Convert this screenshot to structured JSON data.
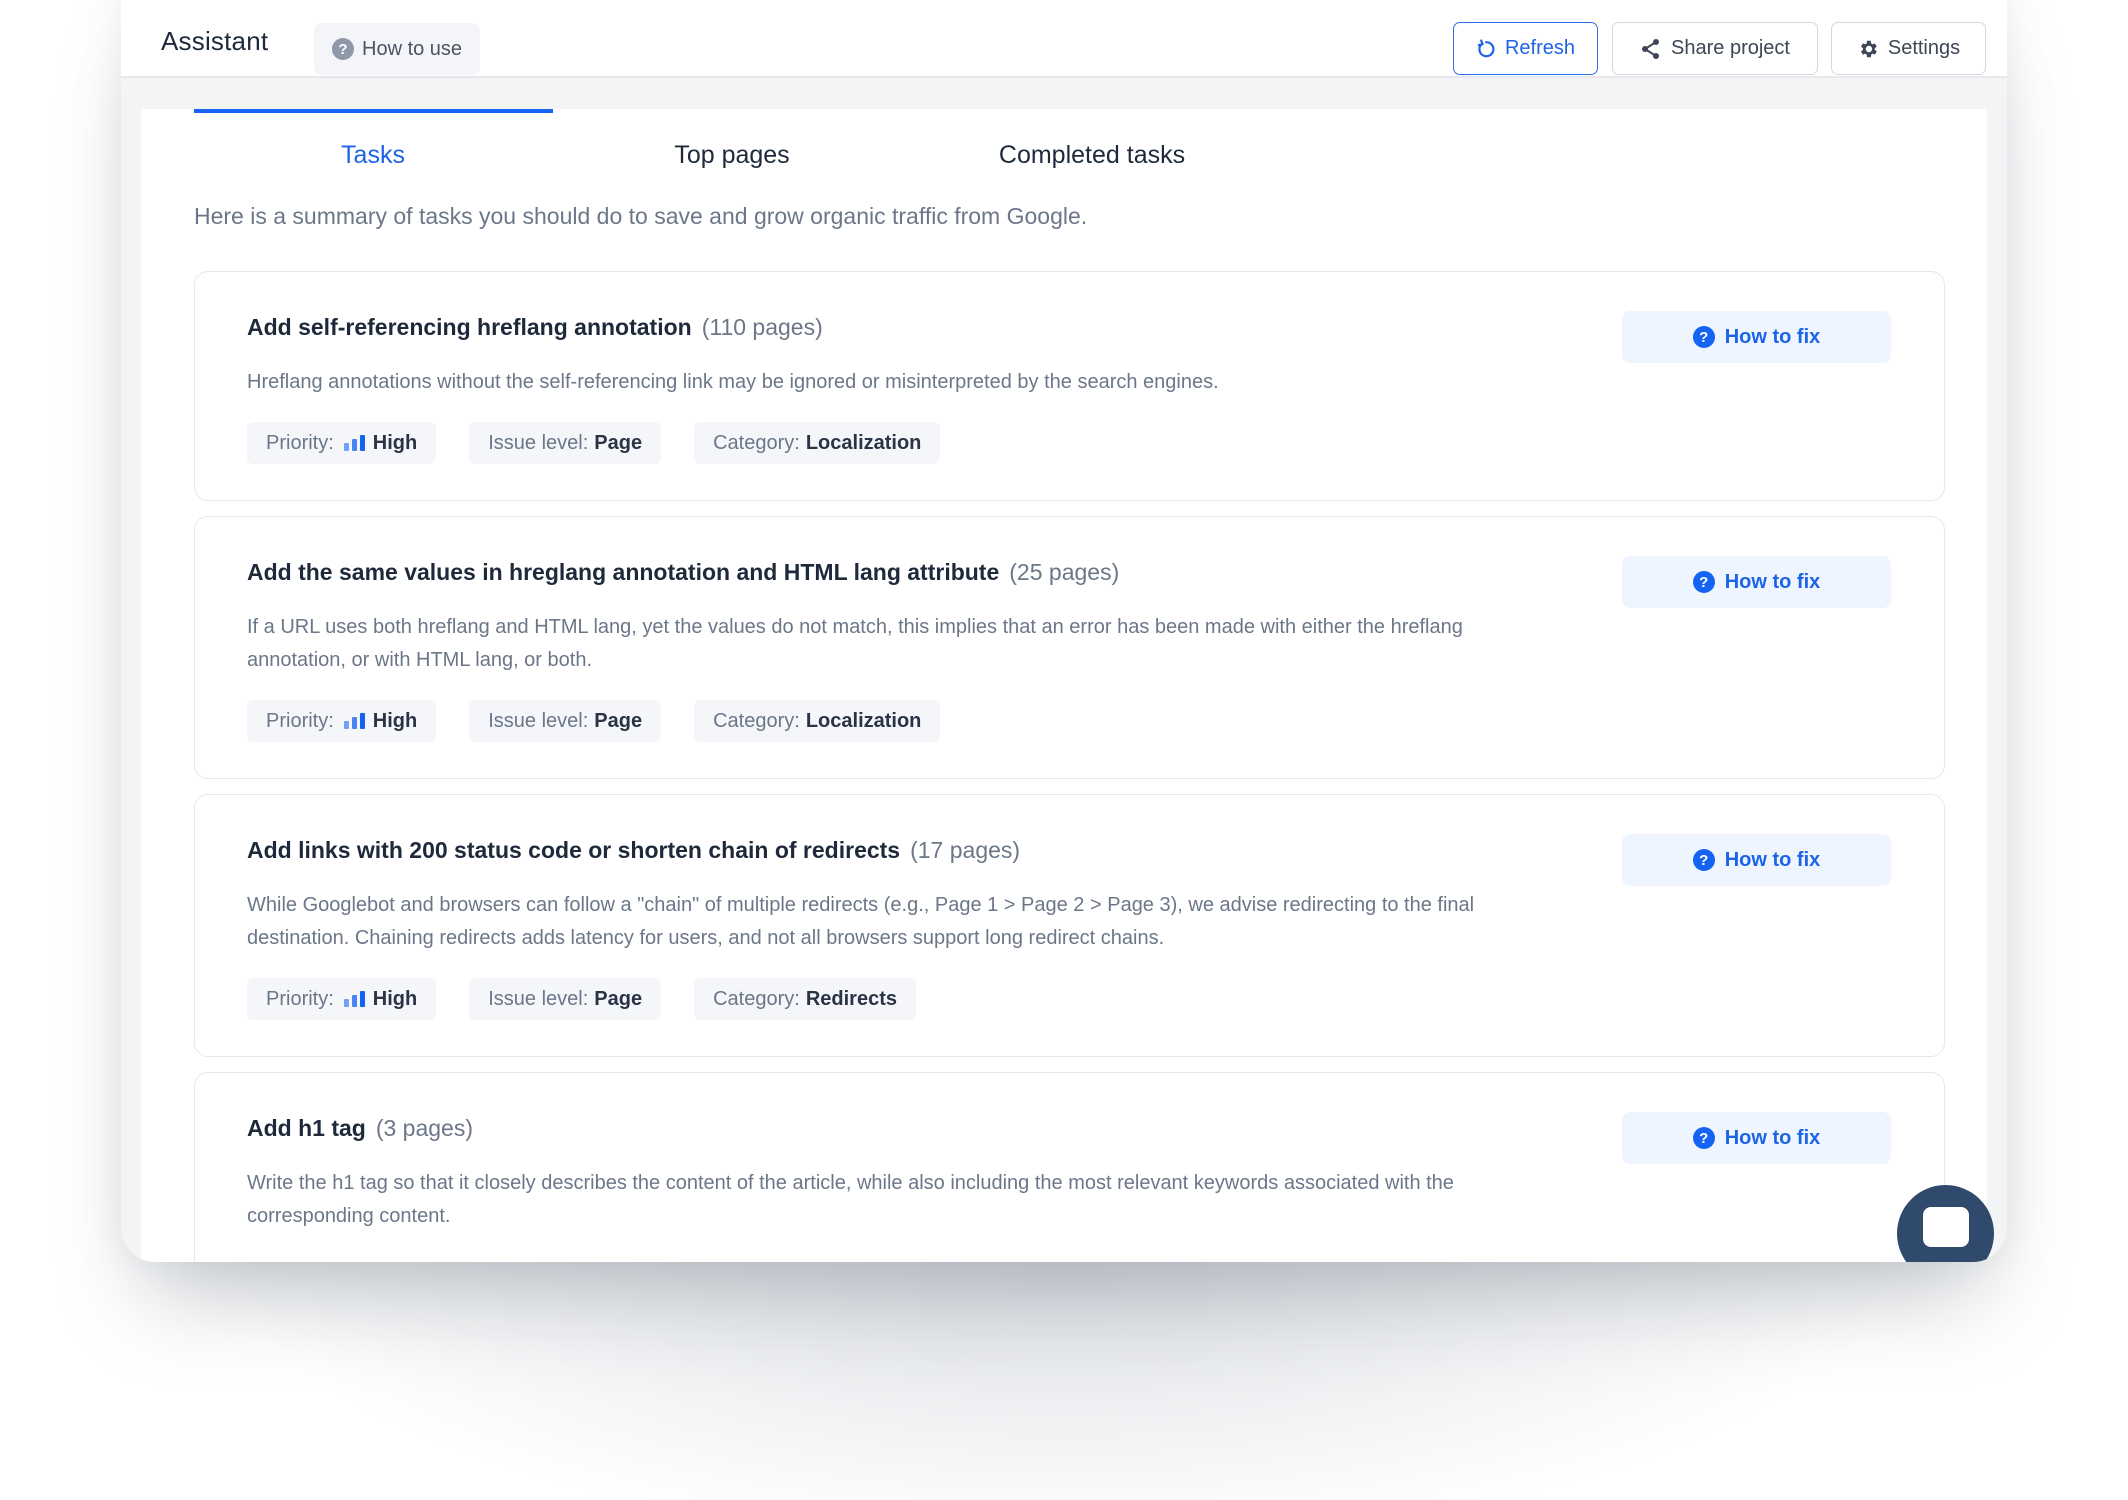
{
  "header": {
    "title": "Assistant",
    "how_to_use": "How to use",
    "buttons": {
      "refresh": "Refresh",
      "share": "Share project",
      "settings": "Settings"
    }
  },
  "tabs": [
    {
      "label": "Tasks",
      "active": true
    },
    {
      "label": "Top pages",
      "active": false
    },
    {
      "label": "Completed tasks",
      "active": false
    }
  ],
  "summary": "Here is a summary of tasks you should do to save and grow organic traffic from Google.",
  "labels": {
    "priority": "Priority:",
    "issue_level": "Issue level:",
    "category": "Category:",
    "how_to_fix": "How to fix"
  },
  "tasks": [
    {
      "title": "Add self-referencing hreflang annotation",
      "count": "(110 pages)",
      "description": "Hreflang annotations without the self-referencing link may be ignored or misinterpreted by the search engines.",
      "priority": "High",
      "issue_level": "Page",
      "category": "Localization"
    },
    {
      "title": "Add the same values in hreglang annotation and HTML lang attribute",
      "count": "(25 pages)",
      "description": "If a URL uses both hreflang and HTML lang, yet the values do not match, this implies that an error has been made with either the hreflang annotation, or with HTML lang, or both.",
      "priority": "High",
      "issue_level": "Page",
      "category": "Localization"
    },
    {
      "title": "Add links with 200 status code or shorten chain of redirects",
      "count": "(17 pages)",
      "description": "While Googlebot and browsers can follow a \"chain\" of multiple redirects (e.g., Page 1 > Page 2 > Page 3), we advise redirecting to the final destination. Chaining redirects adds latency for users, and not all browsers support long redirect chains.",
      "priority": "High",
      "issue_level": "Page",
      "category": "Redirects"
    },
    {
      "title": "Add h1 tag",
      "count": "(3 pages)",
      "description": "Write the h1 tag so that it closely describes the content of the article, while also including the most relevant keywords associated with the corresponding content.",
      "priority": "",
      "issue_level": "",
      "category": ""
    }
  ],
  "colors": {
    "accent": "#1463f3",
    "chat_bubble": "#2f4a6d"
  }
}
